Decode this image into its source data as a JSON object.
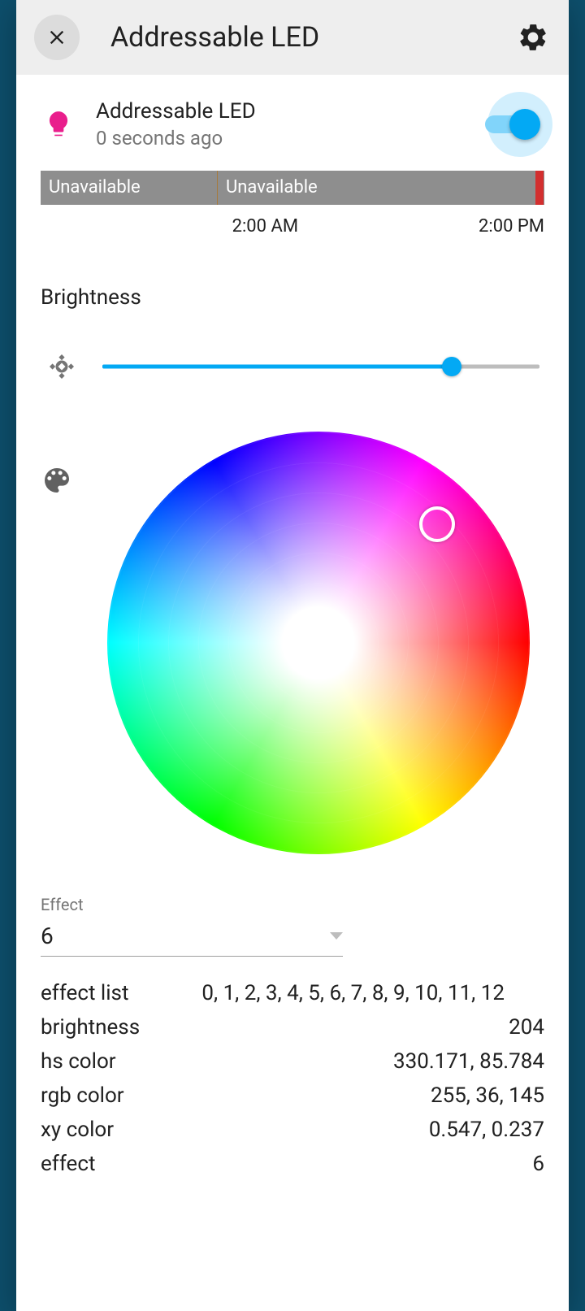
{
  "header": {
    "title": "Addressable LED"
  },
  "entity": {
    "name": "Addressable LED",
    "updated": "0 seconds ago",
    "on": true,
    "icon_color": "#e91e8c"
  },
  "history": {
    "segments": [
      {
        "label": "Unavailable",
        "width_pct": 35
      },
      {
        "label": "Unavailable",
        "width_pct": 63
      }
    ],
    "tick_left": "2:00 AM",
    "tick_right": "2:00 PM"
  },
  "brightness": {
    "label": "Brightness",
    "percent": 80
  },
  "color_picker": {
    "selected_hs": [
      330.171,
      85.784
    ]
  },
  "effect": {
    "label": "Effect",
    "selected": "6"
  },
  "attributes": {
    "effect_list_label": "effect list",
    "effect_list_value": "0, 1, 2, 3, 4, 5, 6, 7, 8, 9, 10, 11, 12",
    "rows": [
      {
        "key": "brightness",
        "value": "204"
      },
      {
        "key": "hs color",
        "value": "330.171, 85.784"
      },
      {
        "key": "rgb color",
        "value": "255, 36, 145"
      },
      {
        "key": "xy color",
        "value": "0.547, 0.237"
      },
      {
        "key": "effect",
        "value": "6"
      }
    ]
  }
}
